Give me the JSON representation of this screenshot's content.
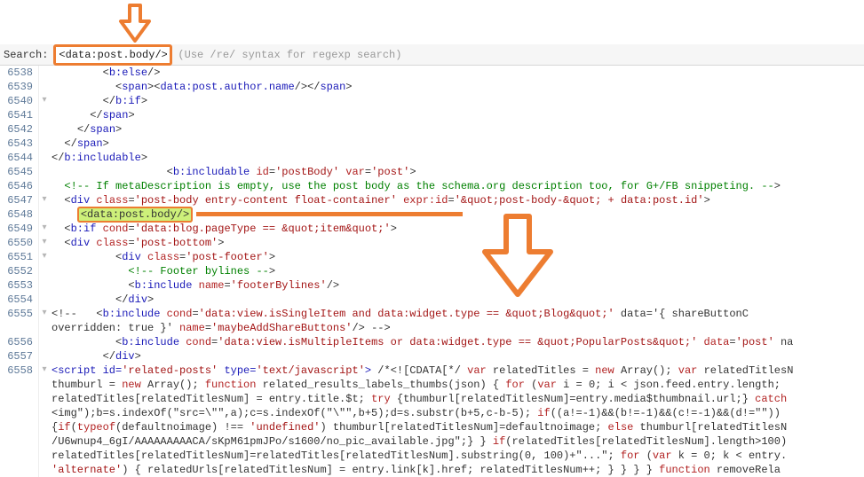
{
  "search": {
    "label": "Search:",
    "value": "<data:post.body/>",
    "hint": "(Use /re/ syntax for regexp search)"
  },
  "lineStart": 6538,
  "foldMarks": {
    "6540": "▾",
    "6547": "▾",
    "6549": "▾",
    "6550": "▾",
    "6551": "▾",
    "6555": "▾",
    "6558": "▾"
  },
  "code": {
    "l6538": "        <b:else/>",
    "l6539": "          <span><data:post.author.name/></span>",
    "l6540": "        </b:if>",
    "l6541": "      </span>",
    "l6542": "    </span>",
    "l6543": "  </span>",
    "l6544": "</b:includable>",
    "l6545": "                  <b:includable id='postBody' var='post'>",
    "l6546": "  <!-- If metaDescription is empty, use the post body as the schema.org description too, for G+/FB snippeting. -->",
    "l6547": "  <div class='post-body entry-content float-container' expr:id='&quot;post-body-&quot; + data:post.id'>",
    "l6548_tag": "<data:post.body/>",
    "l6549": "  <b:if cond='data:blog.pageType == &quot;item&quot;'>",
    "l6550": "  <div class='post-bottom'>",
    "l6551": "          <div class='post-footer'>",
    "l6552": "            <!-- Footer bylines -->",
    "l6553": "            <b:include name='footerBylines'/>",
    "l6554": "          </div>",
    "l6555a": "<!--   <b:include cond='data:view.isSingleItem and data:widget.type == &quot;Blog&quot;' data='{ shareButtonC",
    "l6555b": "overridden: true }' name='maybeAddShareButtons'/> -->",
    "l6556": "          <b:include cond='data:view.isMultipleItems or data:widget.type == &quot;PopularPosts&quot;' data='post' na",
    "l6557": "        </div>",
    "l6558": "<script id='related-posts' type='text/javascript'> /*<![CDATA[*/ var relatedTitles = new Array(); var relatedTitlesN\nthumburl = new Array(); function related_results_labels_thumbs(json) { for (var i = 0; i < json.feed.entry.length;\nrelatedTitles[relatedTitlesNum] = entry.title.$t; try {thumburl[relatedTitlesNum]=entry.media$thumbnail.url;} catch\n<img\");b=s.indexOf(\"src=\\\"\",a);c=s.indexOf(\"\\\"\",b+5);d=s.substr(b+5,c-b-5); if((a!=-1)&&(b!=-1)&&(c!=-1)&&(d!=\"\"))\n{if(typeof(defaultnoimage) !== 'undefined') thumburl[relatedTitlesNum]=defaultnoimage; else thumburl[relatedTitlesN\n/U6wnup4_6gI/AAAAAAAAACA/sKpM61pmJPo/s1600/no_pic_available.jpg\";} } if(relatedTitles[relatedTitlesNum].length>100)\nrelatedTitles[relatedTitlesNum]=relatedTitles[relatedTitlesNum].substring(0, 100)+\"...\"; for (var k = 0; k < entry.\n'alternate') { relatedUrls[relatedTitlesNum] = entry.link[k].href; relatedTitlesNum++; } } } } function removeRela"
  }
}
